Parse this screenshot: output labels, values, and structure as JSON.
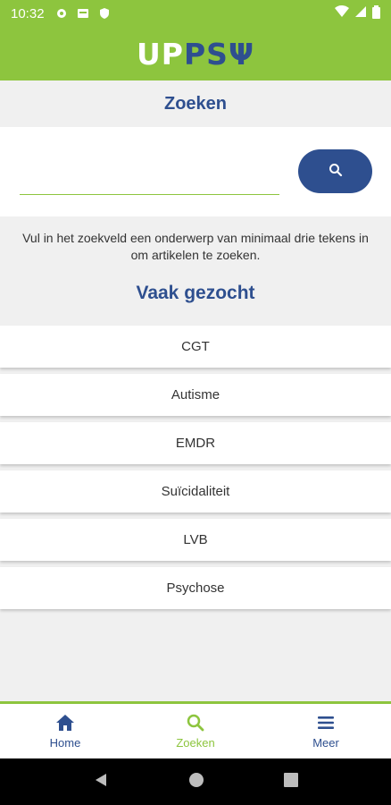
{
  "status_bar": {
    "time": "10:32"
  },
  "app_bar": {
    "logo_part1": "UP",
    "logo_part2": "PSΨ"
  },
  "page": {
    "title": "Zoeken",
    "search": {
      "value": "",
      "placeholder": ""
    },
    "hint": "Vul in het zoekveld een onderwerp van minimaal drie tekens in om artikelen te zoeken.",
    "popular_title": "Vaak gezocht",
    "popular_items": [
      "CGT",
      "Autisme",
      "EMDR",
      "Suïcidaliteit",
      "LVB",
      "Psychose"
    ]
  },
  "bottom_nav": {
    "items": [
      {
        "label": "Home",
        "icon": "home-icon"
      },
      {
        "label": "Zoeken",
        "icon": "search-icon",
        "active": true
      },
      {
        "label": "Meer",
        "icon": "menu-icon"
      }
    ]
  },
  "colors": {
    "brand_green": "#8dc53e",
    "brand_blue": "#2e4f8f"
  }
}
